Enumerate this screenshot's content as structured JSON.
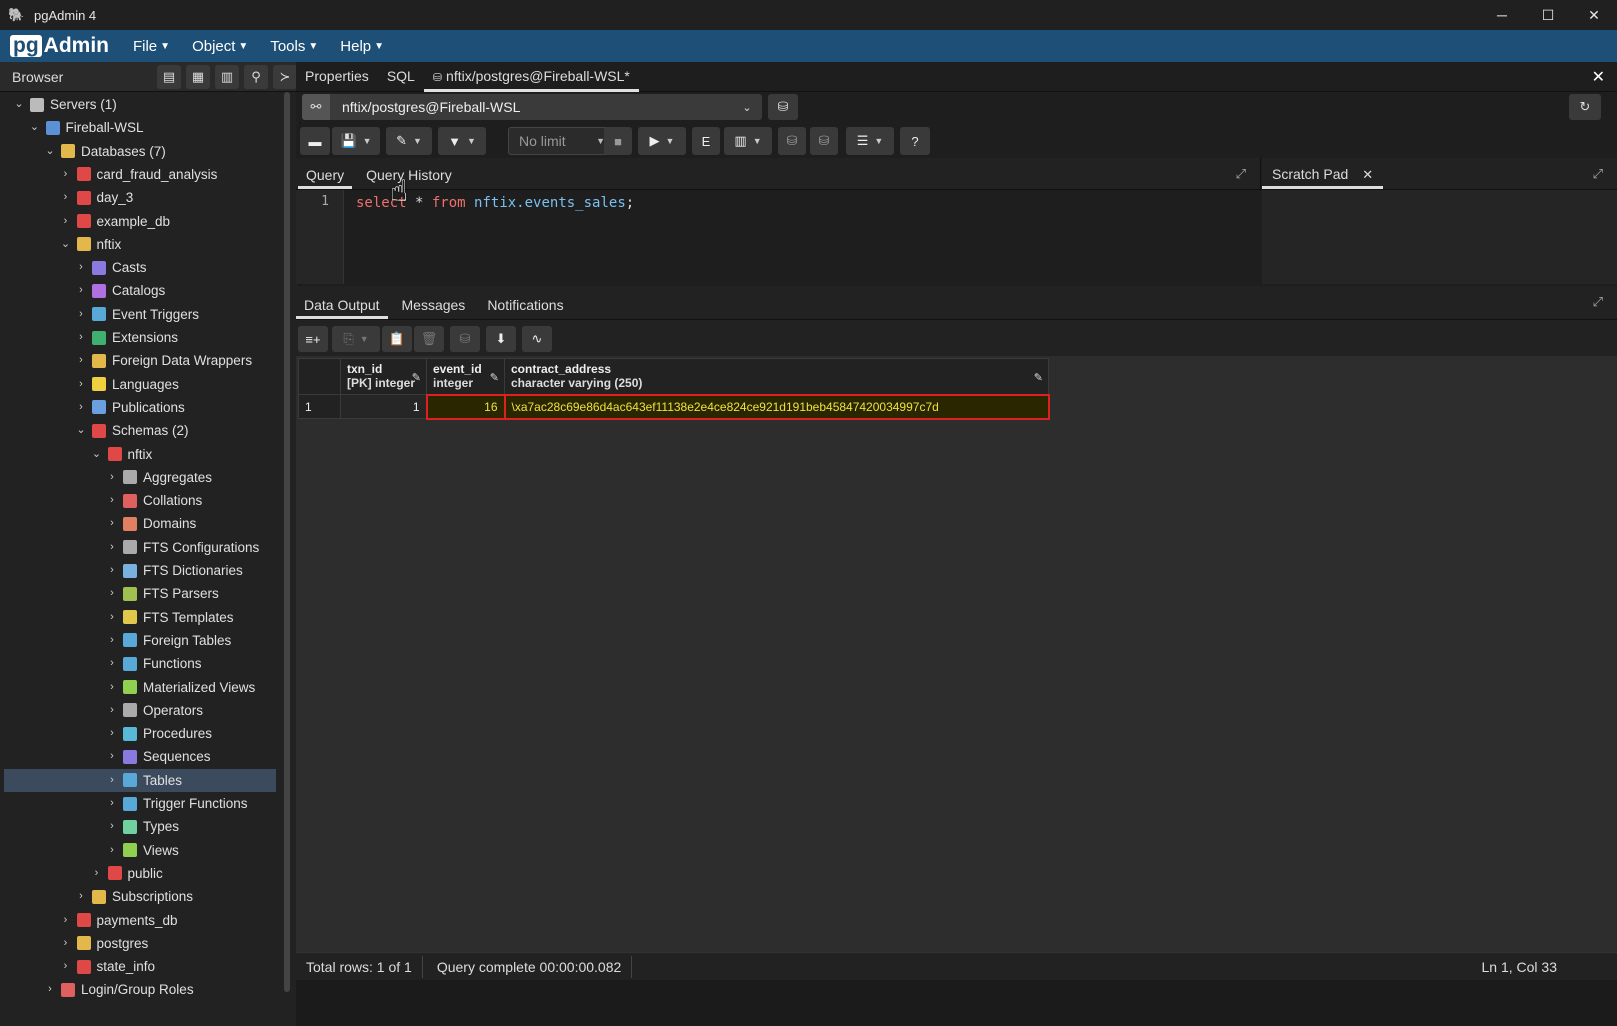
{
  "window": {
    "title": "pgAdmin 4",
    "min": "─",
    "max": "☐",
    "close": "✕"
  },
  "menubar": {
    "logo_pg": "pg",
    "logo_rest": "Admin",
    "items": [
      {
        "label": "File"
      },
      {
        "label": "Object"
      },
      {
        "label": "Tools"
      },
      {
        "label": "Help"
      }
    ]
  },
  "browser": {
    "title": "Browser",
    "tree": [
      {
        "label": "Servers (1)",
        "level": 0,
        "arrow": "⌄",
        "color": "#bbbbbb"
      },
      {
        "label": "Fireball-WSL",
        "level": 1,
        "arrow": "⌄",
        "color": "#5b8fd6"
      },
      {
        "label": "Databases (7)",
        "level": 2,
        "arrow": "⌄",
        "color": "#e2b84a"
      },
      {
        "label": "card_fraud_analysis",
        "level": 3,
        "arrow": "›",
        "color": "#e04848"
      },
      {
        "label": "day_3",
        "level": 3,
        "arrow": "›",
        "color": "#e04848"
      },
      {
        "label": "example_db",
        "level": 3,
        "arrow": "›",
        "color": "#e04848"
      },
      {
        "label": "nftix",
        "level": 3,
        "arrow": "⌄",
        "color": "#e2b84a"
      },
      {
        "label": "Casts",
        "level": 4,
        "arrow": "›",
        "color": "#8a7ae0"
      },
      {
        "label": "Catalogs",
        "level": 4,
        "arrow": "›",
        "color": "#b070e0"
      },
      {
        "label": "Event Triggers",
        "level": 4,
        "arrow": "›",
        "color": "#58a8d8"
      },
      {
        "label": "Extensions",
        "level": 4,
        "arrow": "›",
        "color": "#40b070"
      },
      {
        "label": "Foreign Data Wrappers",
        "level": 4,
        "arrow": "›",
        "color": "#e2b84a"
      },
      {
        "label": "Languages",
        "level": 4,
        "arrow": "›",
        "color": "#f0d040"
      },
      {
        "label": "Publications",
        "level": 4,
        "arrow": "›",
        "color": "#6aa0e0"
      },
      {
        "label": "Schemas (2)",
        "level": 4,
        "arrow": "⌄",
        "color": "#e04848"
      },
      {
        "label": "nftix",
        "level": 5,
        "arrow": "⌄",
        "color": "#e04848"
      },
      {
        "label": "Aggregates",
        "level": 6,
        "arrow": "›",
        "color": "#aaaaaa"
      },
      {
        "label": "Collations",
        "level": 6,
        "arrow": "›",
        "color": "#e06060"
      },
      {
        "label": "Domains",
        "level": 6,
        "arrow": "›",
        "color": "#e08060"
      },
      {
        "label": "FTS Configurations",
        "level": 6,
        "arrow": "›",
        "color": "#aaaaaa"
      },
      {
        "label": "FTS Dictionaries",
        "level": 6,
        "arrow": "›",
        "color": "#7ab0e0"
      },
      {
        "label": "FTS Parsers",
        "level": 6,
        "arrow": "›",
        "color": "#a0c050"
      },
      {
        "label": "FTS Templates",
        "level": 6,
        "arrow": "›",
        "color": "#e2c84a"
      },
      {
        "label": "Foreign Tables",
        "level": 6,
        "arrow": "›",
        "color": "#58a8d8"
      },
      {
        "label": "Functions",
        "level": 6,
        "arrow": "›",
        "color": "#58a8d8"
      },
      {
        "label": "Materialized Views",
        "level": 6,
        "arrow": "›",
        "color": "#90d050"
      },
      {
        "label": "Operators",
        "level": 6,
        "arrow": "›",
        "color": "#aaaaaa"
      },
      {
        "label": "Procedures",
        "level": 6,
        "arrow": "›",
        "color": "#58b8d8"
      },
      {
        "label": "Sequences",
        "level": 6,
        "arrow": "›",
        "color": "#8a7ae0"
      },
      {
        "label": "Tables",
        "level": 6,
        "arrow": "›",
        "color": "#58a8d8",
        "selected": true
      },
      {
        "label": "Trigger Functions",
        "level": 6,
        "arrow": "›",
        "color": "#58a8d8"
      },
      {
        "label": "Types",
        "level": 6,
        "arrow": "›",
        "color": "#70d0a0"
      },
      {
        "label": "Views",
        "level": 6,
        "arrow": "›",
        "color": "#90d050"
      },
      {
        "label": "public",
        "level": 5,
        "arrow": "›",
        "color": "#e04848"
      },
      {
        "label": "Subscriptions",
        "level": 4,
        "arrow": "›",
        "color": "#e2b84a"
      },
      {
        "label": "payments_db",
        "level": 3,
        "arrow": "›",
        "color": "#e04848"
      },
      {
        "label": "postgres",
        "level": 3,
        "arrow": "›",
        "color": "#e2b84a"
      },
      {
        "label": "state_info",
        "level": 3,
        "arrow": "›",
        "color": "#e04848"
      },
      {
        "label": "Login/Group Roles",
        "level": 2,
        "arrow": "›",
        "color": "#e06060"
      }
    ]
  },
  "tabs": {
    "properties": "Properties",
    "sql": "SQL",
    "query_tab": "nftix/postgres@Fireball-WSL*",
    "close_all": "✕"
  },
  "connection": {
    "label": "nftix/postgres@Fireball-WSL"
  },
  "toolbar": {
    "limit": "No limit"
  },
  "editor": {
    "tab_query": "Query",
    "tab_history": "Query History",
    "line_number": "1",
    "code_kw1": "select",
    "code_star": " * ",
    "code_kw2": "from",
    "code_space": " ",
    "code_table": "nftix.events_sales",
    "code_end": ";",
    "scratch_tab": "Scratch Pad",
    "scratch_close": "✕"
  },
  "results": {
    "tab_data": "Data Output",
    "tab_messages": "Messages",
    "tab_notifications": "Notifications",
    "columns": [
      {
        "name": "txn_id",
        "type": "[PK] integer"
      },
      {
        "name": "event_id",
        "type": "integer"
      },
      {
        "name": "contract_address",
        "type": "character varying (250)"
      }
    ],
    "rows": [
      {
        "num": "1",
        "txn_id": "1",
        "event_id": "16",
        "contract_address": "\\xa7ac28c69e86d4ac643ef11138e2e4ce824ce921d191beb45847420034997c7d"
      }
    ]
  },
  "status": {
    "total_rows": "Total rows: 1 of 1",
    "query_complete": "Query complete 00:00:00.082",
    "position": "Ln 1, Col 33"
  }
}
